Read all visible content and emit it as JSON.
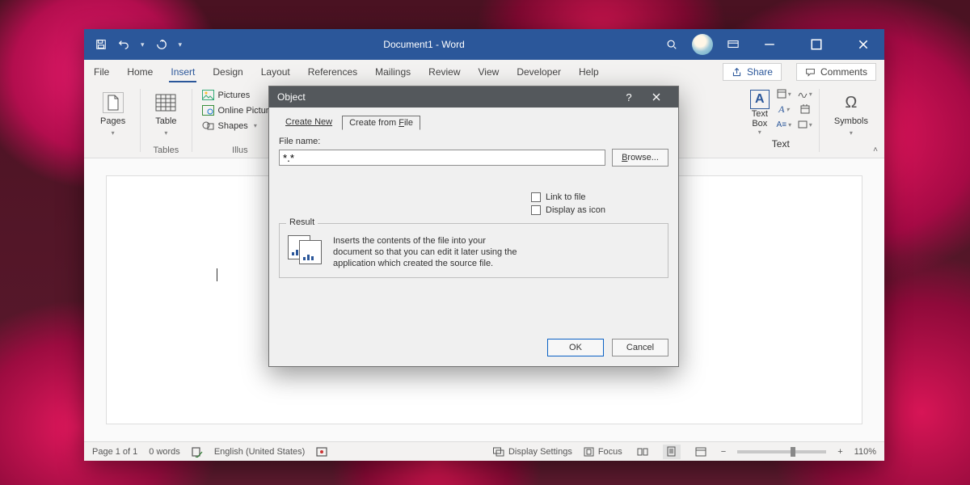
{
  "title": "Document1  -  Word",
  "tabs": {
    "file": "File",
    "home": "Home",
    "insert": "Insert",
    "design": "Design",
    "layout": "Layout",
    "references": "References",
    "mailings": "Mailings",
    "review": "Review",
    "view": "View",
    "developer": "Developer",
    "help": "Help"
  },
  "topright": {
    "share": "Share",
    "comments": "Comments"
  },
  "ribbon": {
    "pages": "Pages",
    "tables_group": "Tables",
    "table": "Table",
    "pictures": "Pictures",
    "online_pictures": "Online Pictures",
    "shapes": "Shapes",
    "illustrations_group": "Illus",
    "textbox": "Text\nBox",
    "text_group": "Text",
    "symbols_group": "Symbols",
    "symbols": "Symbols"
  },
  "dialog": {
    "title": "Object",
    "tab_create_new": "Create New",
    "tab_create_from_file": "Create from File",
    "file_name_label": "File name:",
    "file_name_value": "*.*",
    "browse": "Browse...",
    "link_to_file": "Link to file",
    "display_as_icon": "Display as icon",
    "result_legend": "Result",
    "result_text": "Inserts the contents of the file into your document so that you can edit it later using the application which created the source file.",
    "ok": "OK",
    "cancel": "Cancel"
  },
  "status": {
    "page": "Page 1 of 1",
    "words": "0 words",
    "lang": "English (United States)",
    "display_settings": "Display Settings",
    "focus": "Focus",
    "zoom": "110%"
  },
  "icons": {
    "minus": "−",
    "plus": "+"
  }
}
